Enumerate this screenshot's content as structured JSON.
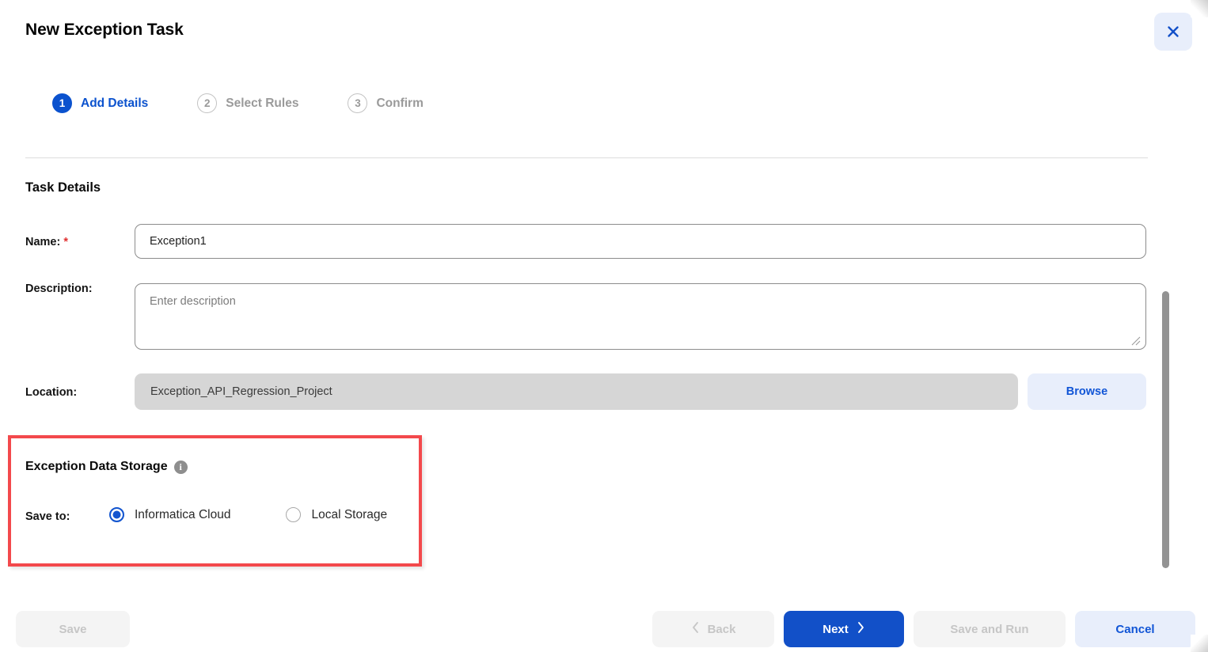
{
  "header": {
    "title": "New Exception Task",
    "close_icon": "close-icon"
  },
  "stepper": {
    "steps": [
      {
        "number": "1",
        "label": "Add Details",
        "state": "active"
      },
      {
        "number": "2",
        "label": "Select Rules",
        "state": "idle"
      },
      {
        "number": "3",
        "label": "Confirm",
        "state": "idle"
      }
    ]
  },
  "task_details": {
    "section_title": "Task Details",
    "name": {
      "label": "Name:",
      "required_marker": "*",
      "value": "Exception1"
    },
    "description": {
      "label": "Description:",
      "value": "",
      "placeholder": "Enter description"
    },
    "location": {
      "label": "Location:",
      "value": "Exception_API_Regression_Project",
      "browse_label": "Browse"
    }
  },
  "exception_data_storage": {
    "title": "Exception Data Storage",
    "info_icon": "info-icon",
    "info_glyph": "i",
    "save_to_label": "Save to:",
    "options": [
      {
        "label": "Informatica Cloud",
        "selected": true
      },
      {
        "label": "Local Storage",
        "selected": false
      }
    ]
  },
  "footer": {
    "save_label": "Save",
    "back_label": "Back",
    "next_label": "Next",
    "save_and_run_label": "Save and Run",
    "cancel_label": "Cancel"
  },
  "colors": {
    "accent_blue": "#1250c8",
    "link_blue": "#1155d6",
    "ghost_blue_bg": "#e8eefb",
    "highlight_red": "#f3494c",
    "disabled_bg": "#f4f4f4",
    "disabled_text": "#c6c6c6",
    "required_red": "#e03030",
    "location_bg": "#d6d6d6"
  }
}
